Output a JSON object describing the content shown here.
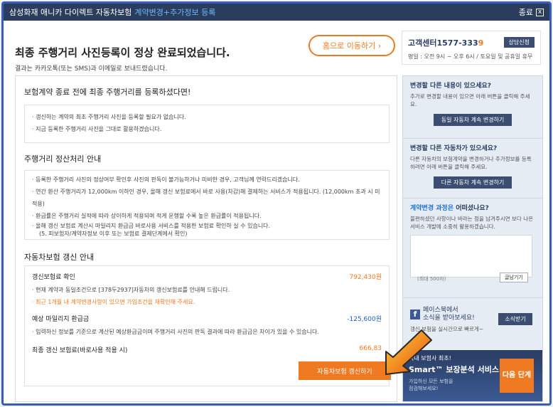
{
  "window": {
    "title_prefix": "삼성화재 애니카 다이렉트 자동차보험",
    "title_accent": "계약변경+추가정보 등록",
    "close_label": "종료",
    "close_symbol": "x"
  },
  "header": {
    "title": "최종 주행거리 사진등록이 정상 완료되었습니다.",
    "subtitle": "결과는 카카오톡(또는 SMS)과 이메일로 보내드렸습니다.",
    "home_button": "홈으로 이동하기 ›",
    "call_center_label": "고객센터",
    "call_center_number": "1577-333",
    "call_center_number_tail": "9",
    "call_center_hours": "평일 : 오전 9시 ~ 오후 6시 / 토요일 및 공휴일 휴무",
    "consult_button": "상담신청"
  },
  "section1": {
    "title": "보험계약 종료 전에 최종 주행거리를 등록하셨다면!",
    "items": [
      "· 갱신하는 계약의 최초 주행거리 사진을 등록할 필요가 없습니다.",
      "· 지금 등록한 주행거리 사진을 그대로 활용하겠습니다."
    ]
  },
  "section2": {
    "title": "주행거리 정산처리 안내",
    "items": [
      "· 등록한 주행거리 사진의 정상여부 확인후 사진의 판독이 불가능하거나 미비한 경우, 고객님께 연락드리겠습니다.",
      "· 연간 환산 주행거리가 12,000km 이하인 경우, 올해 갱신 보험료에서 바로 사용(차감)해 결제하는 서비스가 적용됩니다. (12,000km 초과 시 미 적용)",
      "· 환급률은 주행거리 실적에 따라 상이하게 적용되며 적게 운행할 수록 높은 환급률이 적용됩니다.",
      "· 올해 갱신 보험료 계산시 마일리지 환급금 바로사용 서비스를 적용한 보험료 확인하 실 수 있습니다.",
      "(5. 피보험자/계약자정보 이후 또는 보험료 결제단계에서 확인)"
    ]
  },
  "section3": {
    "title": "자동차보험 갱신 안내",
    "premium_label": "갱신보험료 확인",
    "premium_value": "792,430원",
    "premium_items": [
      "· 현재 계약과 동일조건으로 [378두2937]자동차의 갱신보험료를 안내해 드립니다.",
      "· 최근 1개월 내 계약변경사항이 있으면 가입조건을 재확인해 주세요."
    ],
    "mileage_label": "예상 마일리지 환급금",
    "mileage_value": "-125,600원",
    "mileage_items": [
      "· 입력하신 정보를 기준으로 계산된 예상환급금이며 주행거리 사진의 판독 결과에 따라 환급금은 차이가 있을 수 있습니다."
    ],
    "final_label": "최종 갱신 보험료(바로사용 적용 시)",
    "final_value": "666,83",
    "renew_button": "자동차보험 갱신하기"
  },
  "sidebar": {
    "change1_title": "변경할 다른 내용이 있으세요?",
    "change1_text": "추가로 변경할 내용이 있으면 아래 버튼을 클릭해 주세요.",
    "change1_button": "동일 자동차 계속 변경하기",
    "change2_title": "변경할 다른 자동차가 있으세요?",
    "change2_text": "다른 자동차의 보험계약을 변경하거나 추가정보를 등록하려면 아래 버튼을 클릭해 주세요.",
    "change2_button": "다른 자동차 계속 변경하기",
    "feedback_title_accent": "계약변경 과정은",
    "feedback_title_rest": " 어떠셨나요?",
    "feedback_text": "불편하셨던 사항이나 바라는 점을 남겨주시면 보다 나은 서비스 개발에 소중히 활용하겠습니다.",
    "feedback_counter": "(최대 500자)",
    "feedback_save": "글남기기",
    "fb_title": "페이스북에서",
    "fb_sub": "소식을 받아보세요!",
    "fb_text": "갱신 보험을 실시간으로 빠르게~",
    "fb_button": "소식받기",
    "smart_line1": "국내 보험사 최초!",
    "smart_line2": "Smart™ 보장분석 서비스",
    "smart_line3": "가입하신 모든 보험을",
    "smart_line4": "점검해보세요!",
    "next_button": "다음 단계"
  }
}
